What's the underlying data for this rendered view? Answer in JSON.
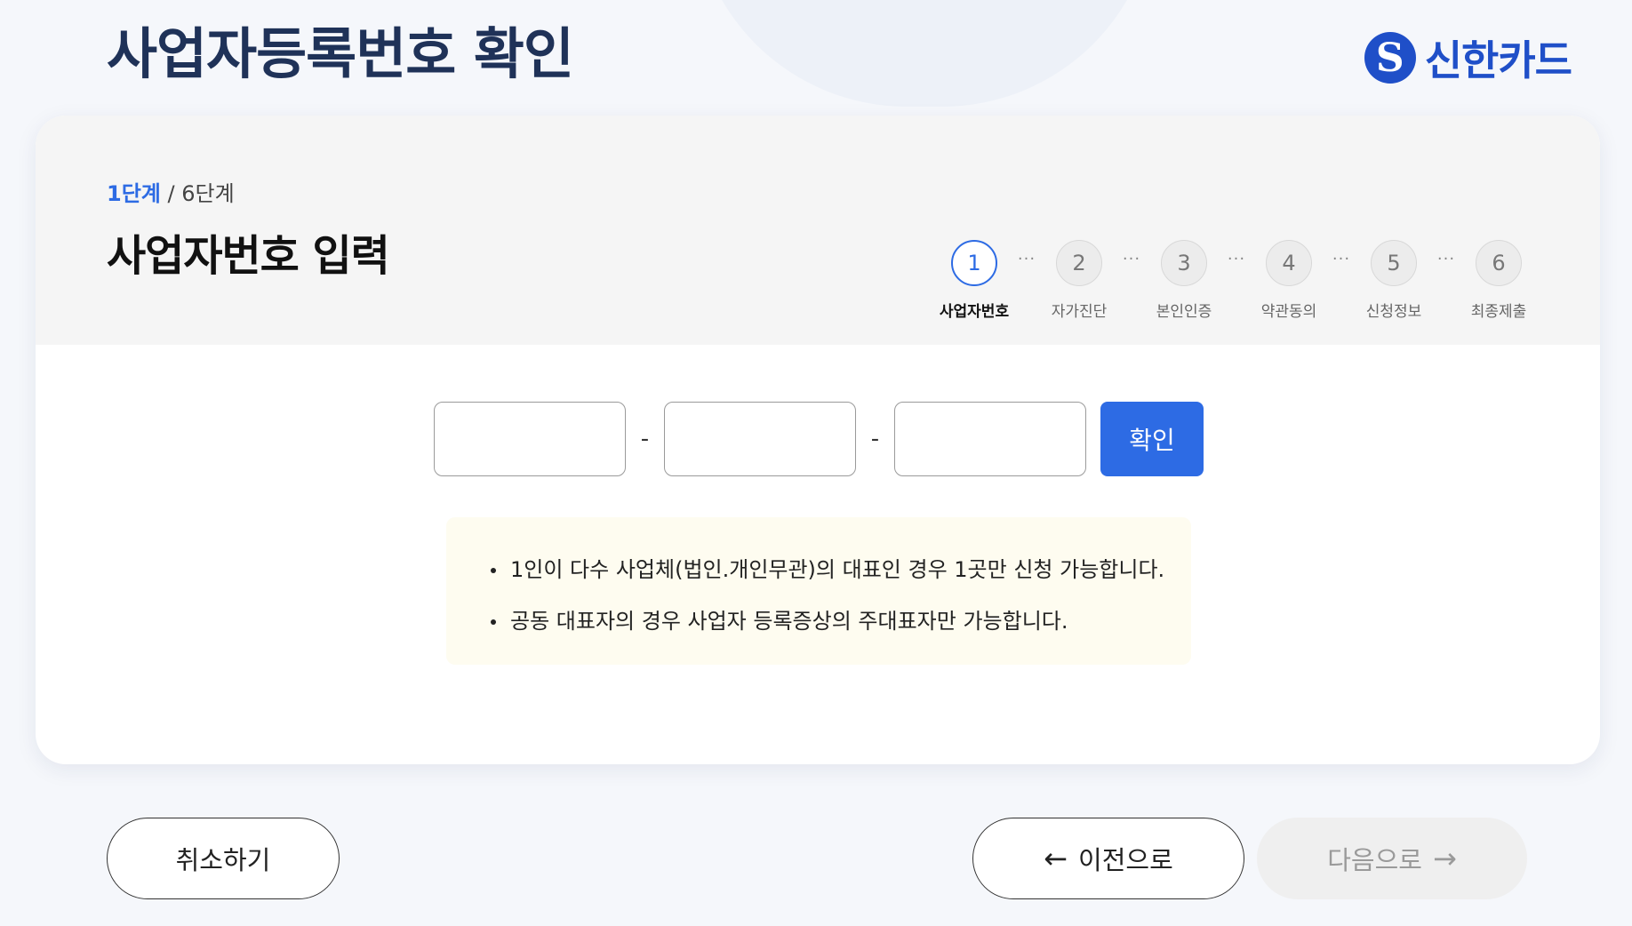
{
  "header": {
    "title": "사업자등록번호 확인",
    "logo_mark": "S",
    "logo_text": "신한카드"
  },
  "progress": {
    "current": "1단계",
    "separator": "/",
    "total": "6단계"
  },
  "section_title": "사업자번호 입력",
  "stepper": {
    "steps": [
      {
        "num": "1",
        "label": "사업자번호",
        "active": true
      },
      {
        "num": "2",
        "label": "자가진단",
        "active": false
      },
      {
        "num": "3",
        "label": "본인인증",
        "active": false
      },
      {
        "num": "4",
        "label": "약관동의",
        "active": false
      },
      {
        "num": "5",
        "label": "신청정보",
        "active": false
      },
      {
        "num": "6",
        "label": "최종제출",
        "active": false
      }
    ],
    "dots": "···"
  },
  "form": {
    "part1_value": "",
    "part2_value": "",
    "part3_value": "",
    "dash": "-",
    "confirm_label": "확인"
  },
  "notice": {
    "items": [
      "1인이 다수 사업체(법인.개인무관)의 대표인 경우 1곳만 신청 가능합니다.",
      "공동 대표자의 경우 사업자 등록증상의 주대표자만 가능합니다."
    ]
  },
  "footer": {
    "cancel_label": "취소하기",
    "prev_label": "이전으로",
    "next_label": "다음으로",
    "prev_icon": "arrow-left-icon",
    "next_icon": "arrow-right-icon"
  },
  "colors": {
    "accent": "#2d6be4",
    "brand": "#1f4fc8",
    "title": "#1f3258",
    "notice_bg": "#fefcf0"
  }
}
